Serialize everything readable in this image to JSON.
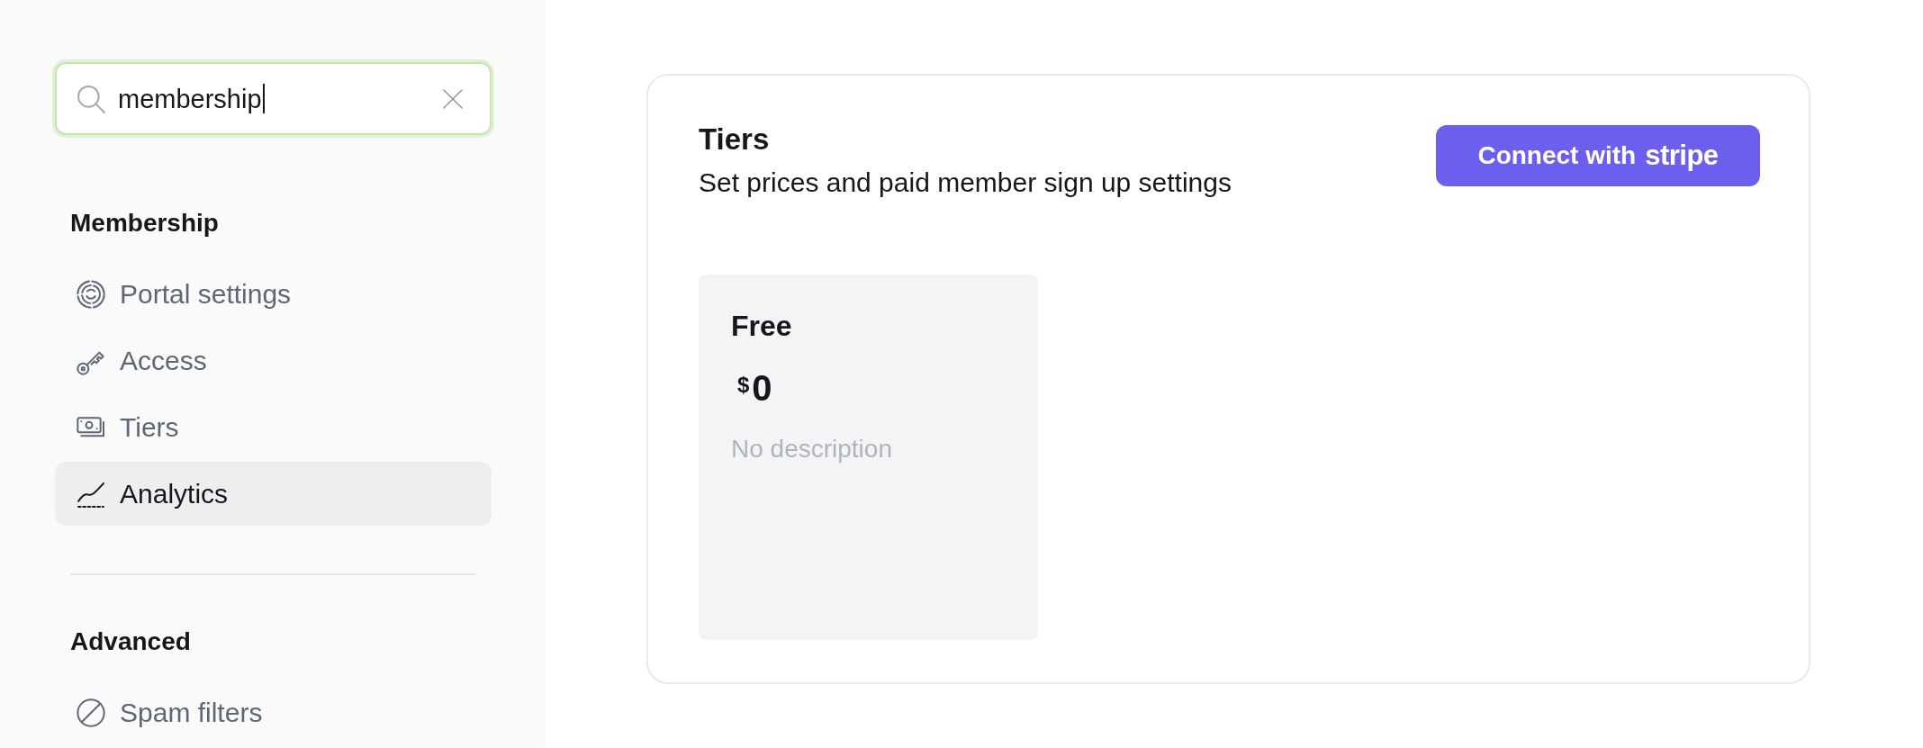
{
  "sidebar": {
    "search": {
      "value": "membership",
      "focused": true
    },
    "sections": [
      {
        "title": "Membership",
        "items": [
          {
            "label": "Portal settings",
            "selected": false
          },
          {
            "label": "Access",
            "selected": false
          },
          {
            "label": "Tiers",
            "selected": false
          },
          {
            "label": "Analytics",
            "selected": true
          }
        ]
      },
      {
        "title": "Advanced",
        "items": [
          {
            "label": "Spam filters",
            "selected": false
          }
        ]
      }
    ]
  },
  "main": {
    "tiers_panel": {
      "title": "Tiers",
      "description": "Set prices and paid member sign up settings",
      "connect_button": {
        "label": "Connect with",
        "logo_text": "stripe"
      },
      "tier_cards": [
        {
          "name": "Free",
          "currency": "$",
          "amount": "0",
          "description": "No description"
        }
      ]
    }
  }
}
